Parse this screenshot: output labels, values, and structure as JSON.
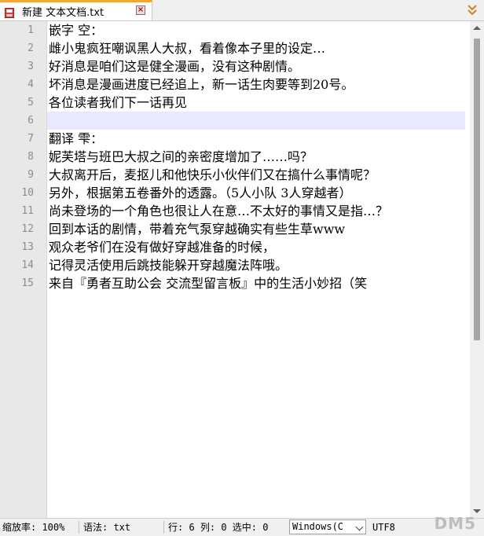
{
  "tab": {
    "title": "新建 文本文档.txt",
    "close_icon": "close-icon",
    "file_icon": "file-icon"
  },
  "editor": {
    "current_line": 6,
    "lines": [
      {
        "num": "1",
        "text": "嵌字 空："
      },
      {
        "num": "2",
        "text": "雌小鬼疯狂嘲讽黑人大叔，看着像本子里的设定…"
      },
      {
        "num": "3",
        "text": "好消息是咱们这是健全漫画，没有这种剧情。"
      },
      {
        "num": "4",
        "text": "坏消息是漫画进度已经追上，新一话生肉要等到20号。"
      },
      {
        "num": "5",
        "text": "各位读者我们下一话再见"
      },
      {
        "num": "6",
        "text": ""
      },
      {
        "num": "7",
        "text": "翻译 雫："
      },
      {
        "num": "8",
        "text": "妮芙塔与班巴大叔之间的亲密度增加了……吗？"
      },
      {
        "num": "9",
        "text": "大叔离开后，麦抠儿和他快乐小伙伴们又在搞什么事情呢？"
      },
      {
        "num": "10",
        "text": "另外，根据第五卷番外的透露。（5人小队 3人穿越者）"
      },
      {
        "num": "11",
        "text": "尚未登场的一个角色也很让人在意…不太好的事情又是指…？"
      },
      {
        "num": "12",
        "text": "回到本话的剧情，带着充气泵穿越确实有些生草www"
      },
      {
        "num": "13",
        "text": "观众老爷们在没有做好穿越准备的时候，"
      },
      {
        "num": "14",
        "text": "记得灵活使用后跳技能躲开穿越魔法阵哦。"
      },
      {
        "num": "15",
        "text": "来自『勇者互助公会 交流型留言板』中的生活小妙招（笑"
      }
    ]
  },
  "statusbar": {
    "zoom": "缩放率: 100%",
    "syntax": "语法: txt",
    "position": "行: 6 列: 0 选中: 0",
    "line_ending": "Windows(C",
    "encoding": "UTF8"
  },
  "watermark": "DM5"
}
